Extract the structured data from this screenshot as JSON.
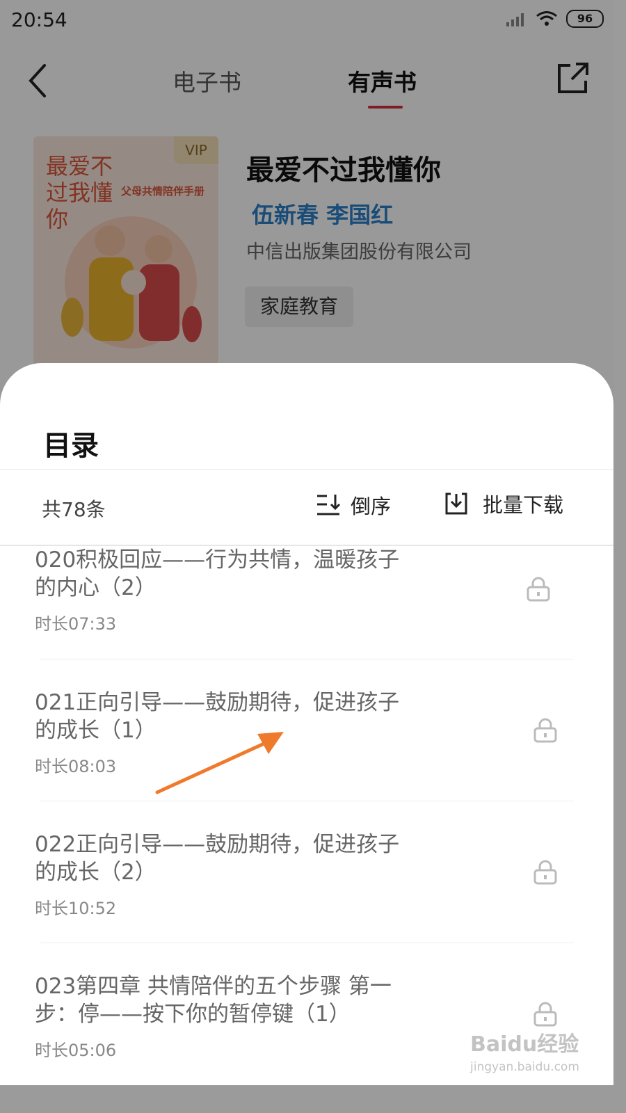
{
  "status": {
    "time": "20:54",
    "battery": "96"
  },
  "nav": {
    "tabs": [
      "电子书",
      "有声书"
    ],
    "active_tab": "有声书"
  },
  "book": {
    "cover_title": "最爱不过我懂你",
    "cover_subtitle": "父母共情陪伴手册",
    "vip_badge": "VIP",
    "title": "最爱不过我懂你",
    "authors": "伍新春 李国红",
    "publisher": "中信出版集团股份有限公司",
    "tag": "家庭教育"
  },
  "sheet": {
    "title": "目录",
    "count": "共78条",
    "sort_label": "倒序",
    "download_label": "批量下载",
    "chapters": [
      {
        "title": "020积极回应——行为共情，温暖孩子的内心（2）",
        "duration": "时长07:33"
      },
      {
        "title": "021正向引导——鼓励期待，促进孩子的成长（1）",
        "duration": "时长08:03"
      },
      {
        "title": "022正向引导——鼓励期待，促进孩子的成长（2）",
        "duration": "时长10:52"
      },
      {
        "title": "023第四章 共情陪伴的五个步骤 第一步：停——按下你的暂停键（1）",
        "duration": "时长05:06"
      }
    ]
  },
  "watermark": {
    "brand": "Baidu经验",
    "url": "jingyan.baidu.com"
  },
  "colors": {
    "accent": "#d6303b",
    "author": "#2c7fc9",
    "annotation_arrow": "#f07a2c"
  }
}
